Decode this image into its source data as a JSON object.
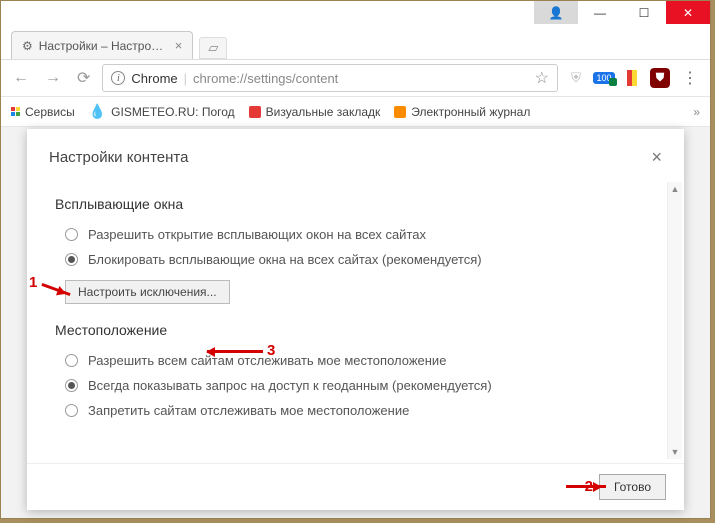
{
  "window": {
    "tab_title": "Настройки – Настройки",
    "url_scheme": "Chrome",
    "url_path": "chrome://settings/content"
  },
  "bookmarks": {
    "apps": "Сервисы",
    "gismeteo": "GISMETEO.RU: Погод",
    "vis": "Визуальные закладк",
    "journal": "Электронный журнал"
  },
  "dialog": {
    "title": "Настройки контента",
    "close": "×",
    "done": "Готово"
  },
  "popups": {
    "heading": "Всплывающие окна",
    "allow": "Разрешить открытие всплывающих окон на всех сайтах",
    "block": "Блокировать всплывающие окна на всех сайтах (рекомендуется)",
    "exceptions": "Настроить исключения..."
  },
  "location": {
    "heading": "Местоположение",
    "allow": "Разрешить всем сайтам отслеживать мое местоположение",
    "ask": "Всегда показывать запрос на доступ к геоданным (рекомендуется)",
    "deny": "Запретить сайтам отслеживать мое местоположение"
  },
  "annotations": {
    "n1": "1",
    "n2": "2",
    "n3": "3"
  }
}
